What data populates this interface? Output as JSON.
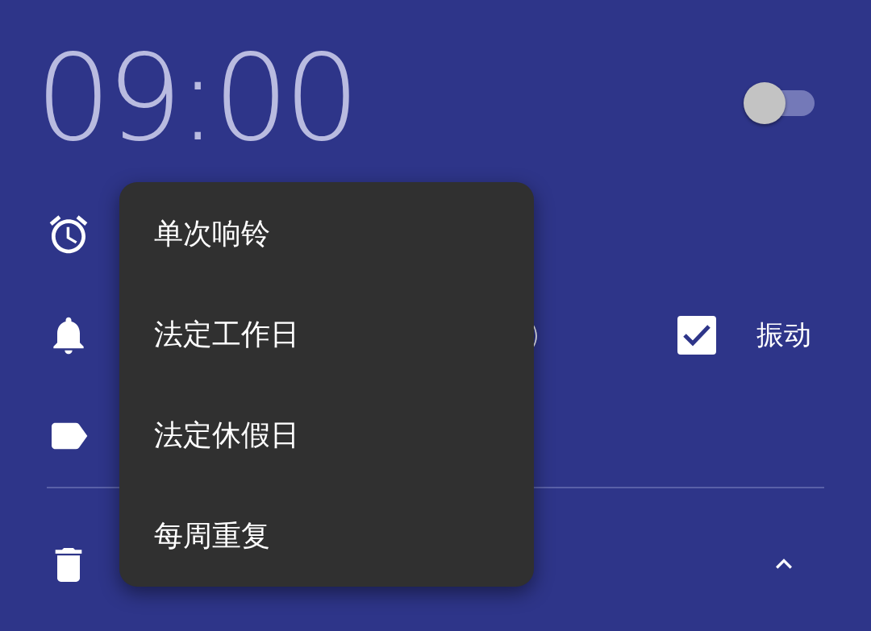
{
  "alarm": {
    "time": "09:00",
    "enabled": false
  },
  "ringtone": {
    "label": ")"
  },
  "vibrate": {
    "label": "振动",
    "checked": true
  },
  "details": {
    "expanded": true
  },
  "repeat_menu": {
    "items": [
      {
        "label": "单次响铃"
      },
      {
        "label": "法定工作日"
      },
      {
        "label": "法定休假日"
      },
      {
        "label": "每周重复"
      }
    ]
  }
}
